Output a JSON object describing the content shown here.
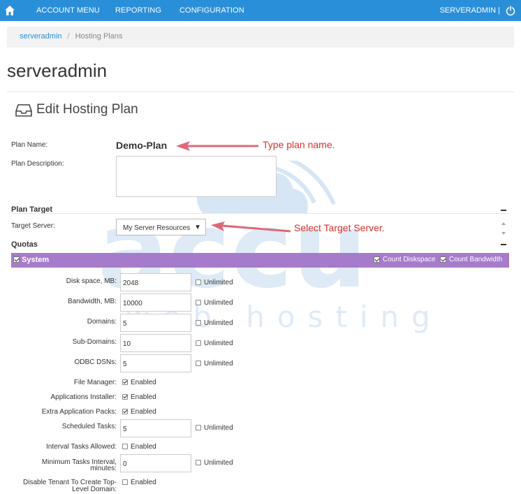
{
  "nav": {
    "items": [
      "ACCOUNT MENU",
      "REPORTING",
      "CONFIGURATION"
    ],
    "user": "SERVERADMIN |",
    "home_icon": "home-icon",
    "power_icon": "power-icon"
  },
  "breadcrumb": {
    "root": "serveradmin",
    "separator": "/",
    "current": "Hosting Plans"
  },
  "page": {
    "title": "serveradmin",
    "section_title": "Edit Hosting Plan"
  },
  "form": {
    "plan_name_label": "Plan Name:",
    "plan_name_value": "Demo-Plan",
    "plan_description_label": "Plan Description:",
    "plan_description_value": "",
    "plan_target_heading": "Plan Target",
    "target_server_label": "Target Server:",
    "target_server_value": "My Server Resources",
    "quotas_heading": "Quotas"
  },
  "annotations": {
    "plan_name": "Type plan name.",
    "target_server": "Select Target Server."
  },
  "system": {
    "title": "System",
    "count_diskspace": "Count Diskspace",
    "count_bandwidth": "Count Bandwidth",
    "rows": [
      {
        "label": "Disk space, MB:",
        "value": "2048",
        "check": "Unlimited"
      },
      {
        "label": "Bandwidth, MB:",
        "value": "10000",
        "check": "Unlimited"
      },
      {
        "label": "Domains:",
        "value": "5",
        "check": "Unlimited"
      },
      {
        "label": "Sub-Domains:",
        "value": "10",
        "check": "Unlimited"
      },
      {
        "label": "ODBC DSNs:",
        "value": "5",
        "check": "Unlimited"
      }
    ],
    "file_manager": {
      "label": "File Manager:",
      "check": "Enabled"
    },
    "apps_installer": {
      "label": "Applications Installer:",
      "check": "Enabled"
    },
    "extra_apps": {
      "label": "Extra Application Packs:",
      "check": "Enabled"
    },
    "scheduled_tasks": {
      "label": "Scheduled Tasks:",
      "value": "5",
      "check": "Unlimited"
    },
    "interval_tasks": {
      "label": "Interval Tasks Allowed:",
      "check": "Enabled"
    },
    "min_interval": {
      "label_1": "Minimum Tasks Interval,",
      "label_2": "minutes:",
      "value": "0",
      "check": "Unlimited"
    },
    "disable_tenant": {
      "label_1": "Disable Tenant To Create Top-",
      "label_2": "Level Domain:",
      "check": "Enabled"
    }
  },
  "watermark": {
    "line1": "accu",
    "line2": "web hosting"
  },
  "colors": {
    "nav": "#2a8fd9",
    "system_bar": "#a77bcb",
    "annotation": "#d9312f"
  }
}
